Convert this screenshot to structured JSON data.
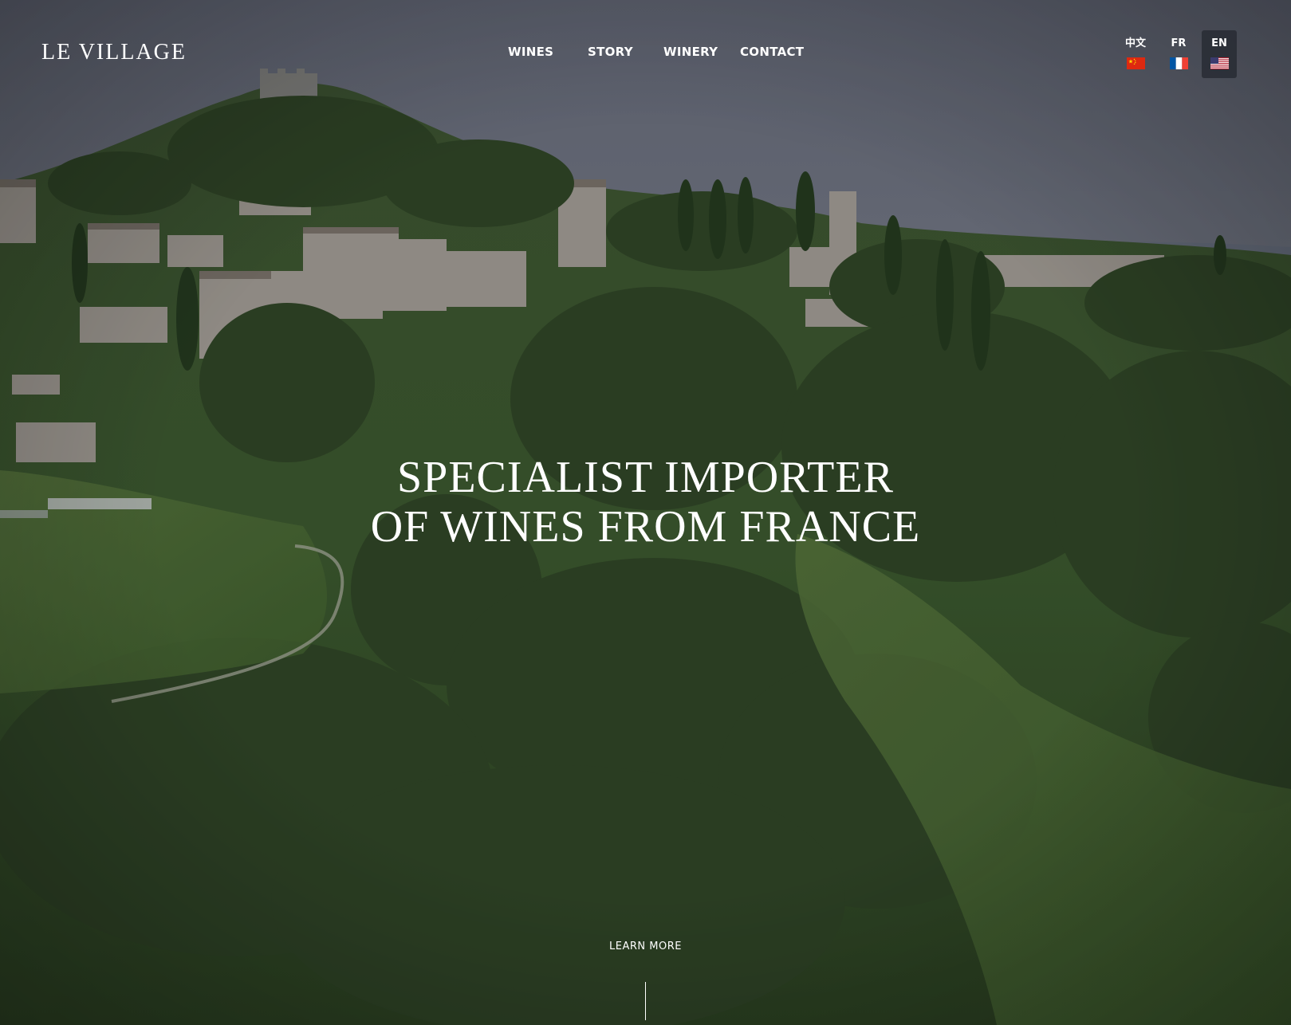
{
  "brand": {
    "name": "LE VILLAGE"
  },
  "nav": {
    "items": [
      {
        "label": "WINES"
      },
      {
        "label": "STORY"
      },
      {
        "label": "WINERY"
      },
      {
        "label": "CONTACT"
      }
    ]
  },
  "languages": [
    {
      "code": "中文",
      "flag": "china-flag-icon",
      "active": false
    },
    {
      "code": "FR",
      "flag": "france-flag-icon",
      "active": false
    },
    {
      "code": "EN",
      "flag": "usa-flag-icon",
      "active": true
    }
  ],
  "hero": {
    "headline_line1": "SPECIALIST IMPORTER",
    "headline_line2": "OF WINES FROM FRANCE",
    "cta_label": "LEARN MORE"
  },
  "colors": {
    "sky": "#6b7180",
    "foliage": "#3f5a2f",
    "active_lang_bg": "#2c3038",
    "text": "#ffffff"
  }
}
